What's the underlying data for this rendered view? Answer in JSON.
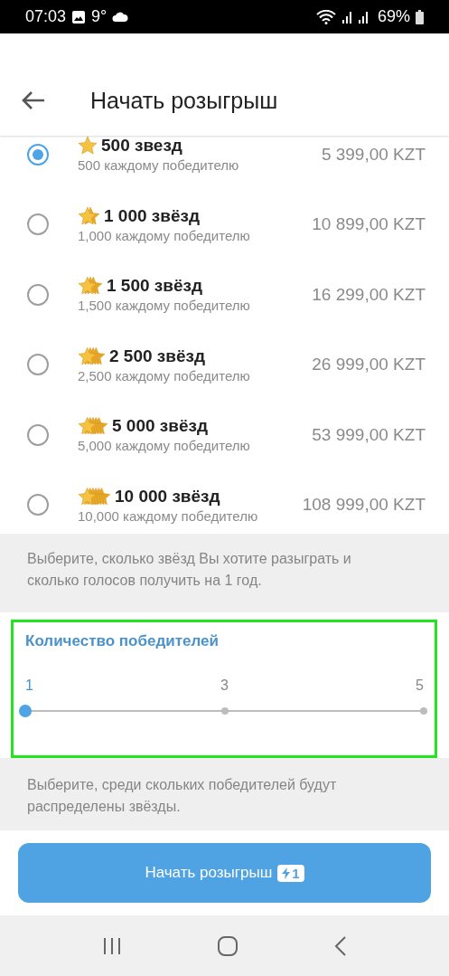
{
  "status_bar": {
    "time": "07:03",
    "temperature": "9°",
    "battery": "69%"
  },
  "header": {
    "title": "Начать розыгрыш"
  },
  "options": [
    {
      "title": "500 звезд",
      "subtitle": "500 каждому победителю",
      "price": "5 399,00 KZT",
      "selected": true
    },
    {
      "title": "1 000 звёзд",
      "subtitle": "1,000 каждому победителю",
      "price": "10 899,00 KZT",
      "selected": false
    },
    {
      "title": "1 500 звёзд",
      "subtitle": "1,500 каждому победителю",
      "price": "16 299,00 KZT",
      "selected": false
    },
    {
      "title": "2 500 звёзд",
      "subtitle": "2,500 каждому победителю",
      "price": "26 999,00 KZT",
      "selected": false
    },
    {
      "title": "5 000 звёзд",
      "subtitle": "5,000 каждому победителю",
      "price": "53 999,00 KZT",
      "selected": false
    },
    {
      "title": "10 000 звёзд",
      "subtitle": "10,000 каждому победителю",
      "price": "108 999,00 KZT",
      "selected": false
    }
  ],
  "options_hint": "Выберите, сколько звёзд Вы хотите разыграть и сколько голосов получить на 1 год.",
  "winners": {
    "title": "Количество победителей",
    "level": 0,
    "ticks": [
      {
        "label": "1",
        "selected": true
      },
      {
        "label": "3",
        "selected": false
      },
      {
        "label": "5",
        "selected": false
      }
    ]
  },
  "winners_hint": "Выберите, среди скольких победителей будут распределены звёзды.",
  "start_button": {
    "label": "Начать розыгрыш",
    "badge": "1"
  }
}
